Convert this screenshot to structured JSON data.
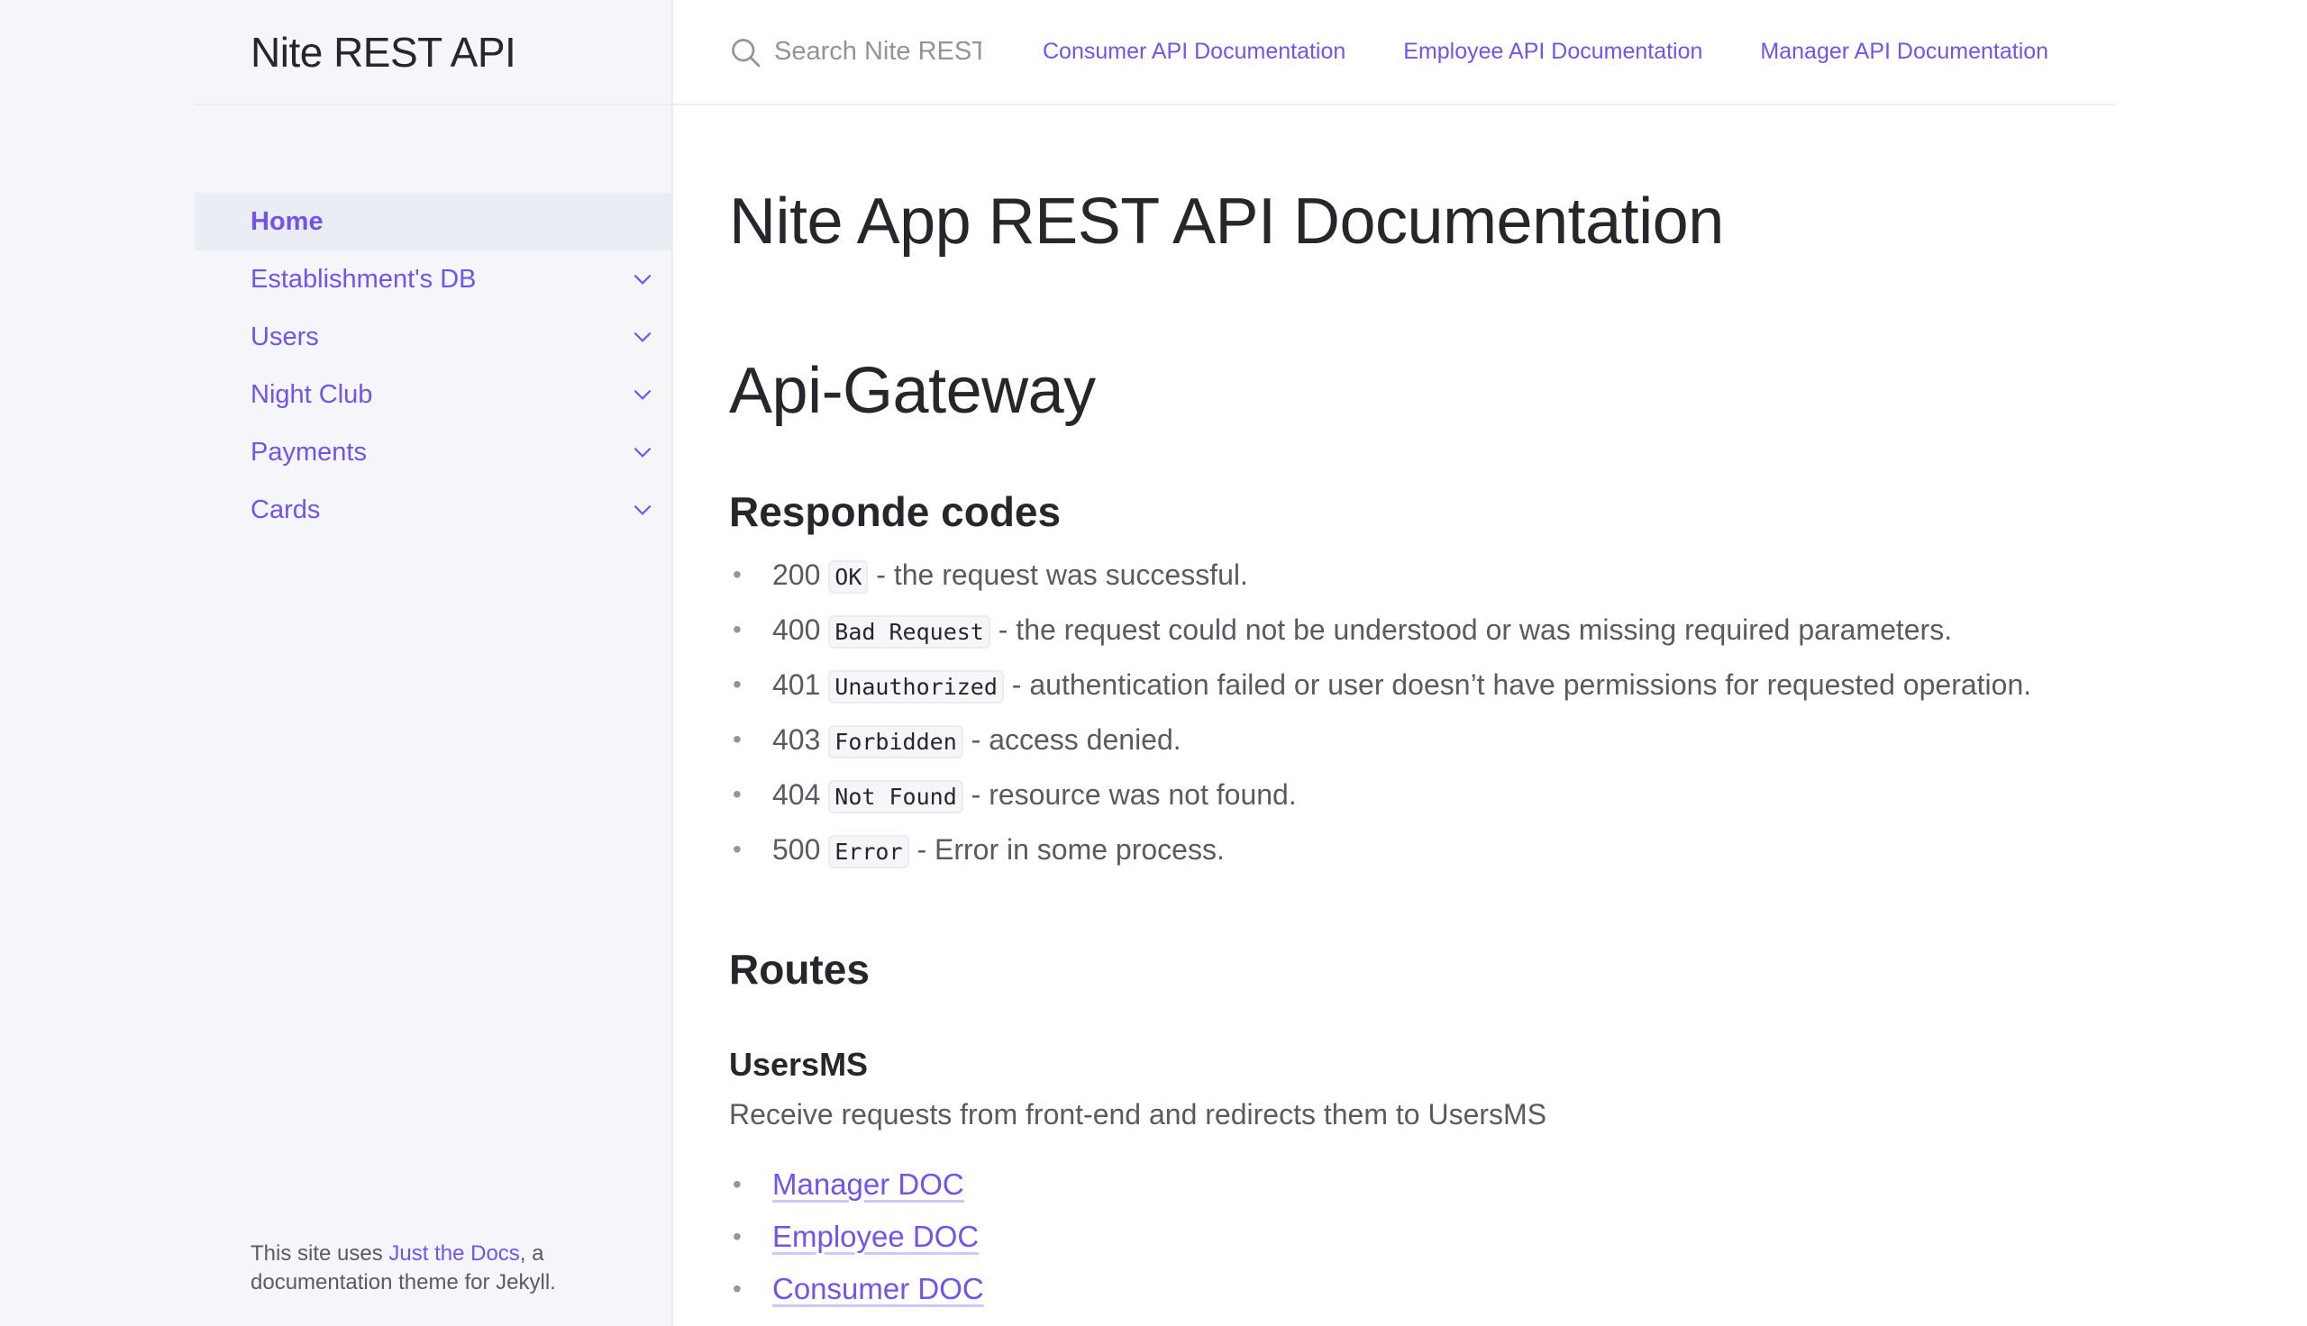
{
  "sidebar": {
    "site_title": "Nite REST API",
    "items": [
      {
        "label": "Home",
        "active": true
      },
      {
        "label": "Establishment's DB",
        "expandable": true
      },
      {
        "label": "Users",
        "expandable": true
      },
      {
        "label": "Night Club",
        "expandable": true
      },
      {
        "label": "Payments",
        "expandable": true
      },
      {
        "label": "Cards",
        "expandable": true
      }
    ],
    "footer": {
      "prefix": "This site uses ",
      "link": "Just the Docs",
      "suffix": ", a documentation theme for Jekyll."
    }
  },
  "header": {
    "search_placeholder": "Search Nite REST API",
    "aux_links": [
      "Consumer API Documentation",
      "Employee API Documentation",
      "Manager API Documentation"
    ]
  },
  "main": {
    "title": "Nite App REST API Documentation",
    "section": "Api-Gateway",
    "codes_heading": "Responde codes",
    "codes": [
      {
        "num": "200",
        "code": "OK",
        "desc": " - the request was successful."
      },
      {
        "num": "400",
        "code": "Bad Request",
        "desc": " - the request could not be understood or was missing required parameters."
      },
      {
        "num": "401",
        "code": "Unauthorized",
        "desc": " - authentication failed or user doesn’t have permissions for requested operation."
      },
      {
        "num": "403",
        "code": "Forbidden",
        "desc": " - access denied."
      },
      {
        "num": "404",
        "code": "Not Found",
        "desc": " - resource was not found."
      },
      {
        "num": "500",
        "code": "Error",
        "desc": " - Error in some process."
      }
    ],
    "routes_heading": "Routes",
    "usersms_heading": "UsersMS",
    "usersms_desc": "Receive requests from front-end and redirects them to UsersMS",
    "doc_links": [
      "Manager DOC",
      "Employee DOC",
      "Consumer DOC"
    ]
  },
  "colors": {
    "accent": "#7253ed",
    "sidebar_bg": "#f5f6fa",
    "text": "#27262b",
    "muted_text": "#5c5962"
  }
}
